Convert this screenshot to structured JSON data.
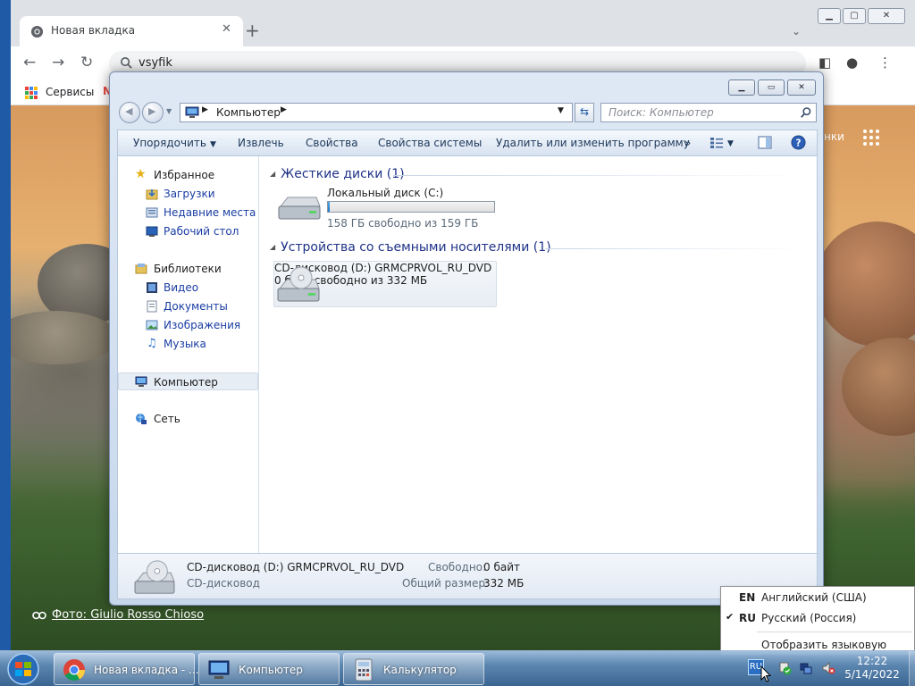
{
  "chrome": {
    "tab_title": "Новая вкладка",
    "omnibox_text": "vsyfik",
    "bookmark_apps_label": "Сервисы",
    "bookmark_partial": "N",
    "content_corner_text": "нки",
    "photo_prefix": "Фото: ",
    "photo_credit": "Giulio Rosso Chioso"
  },
  "explorer": {
    "breadcrumb": "Компьютер",
    "search_placeholder": "Поиск: Компьютер",
    "commands": [
      {
        "label": "Упорядочить"
      },
      {
        "label": "Извлечь"
      },
      {
        "label": "Свойства"
      },
      {
        "label": "Свойства системы"
      },
      {
        "label": "Удалить или изменить программу"
      }
    ],
    "more_label": "»",
    "nav": {
      "favorites": "Избранное",
      "downloads": "Загрузки",
      "recent": "Недавние места",
      "desktop": "Рабочий стол",
      "libraries": "Библиотеки",
      "video": "Видео",
      "documents": "Документы",
      "images": "Изображения",
      "music": "Музыка",
      "computer": "Компьютер",
      "network": "Сеть"
    },
    "groups": {
      "hard_drives": "Жесткие диски (1)",
      "removable": "Устройства со съемными носителями (1)"
    },
    "drive_c": {
      "name": "Локальный диск (C:)",
      "free_text": "158 ГБ свободно из 159 ГБ",
      "used_fraction": 0.006
    },
    "drive_d": {
      "name": "CD-дисковод (D:)",
      "label": "GRMCPRVOL_RU_DVD",
      "free_text": "0 байт свободно из 332 МБ"
    },
    "details": {
      "title": "CD-дисковод (D:) GRMCPRVOL_RU_DVD",
      "type": "CD-дисковод",
      "free_label": "Свободно:",
      "free_value": "0 байт",
      "total_label": "Общий размер:",
      "total_value": "332 МБ"
    }
  },
  "language_menu": {
    "items": [
      {
        "code": "EN",
        "name": "Английский (США)",
        "checked": false
      },
      {
        "code": "RU",
        "name": "Русский (Россия)",
        "checked": true
      }
    ],
    "show_bar": "Отобразить языковую панель",
    "check_mark": "✔"
  },
  "taskbar": {
    "tasks": [
      {
        "label": "Новая вкладка - ..."
      },
      {
        "label": "Компьютер"
      },
      {
        "label": "Калькулятор"
      }
    ],
    "lang_indicator": "RU",
    "time": "12:22",
    "date": "5/14/2022"
  },
  "colors": {
    "accent_blue": "#1f5aa6",
    "link_blue": "#1a3da3",
    "group_header": "#1e3287",
    "drive_bar": "#1b75c9"
  }
}
